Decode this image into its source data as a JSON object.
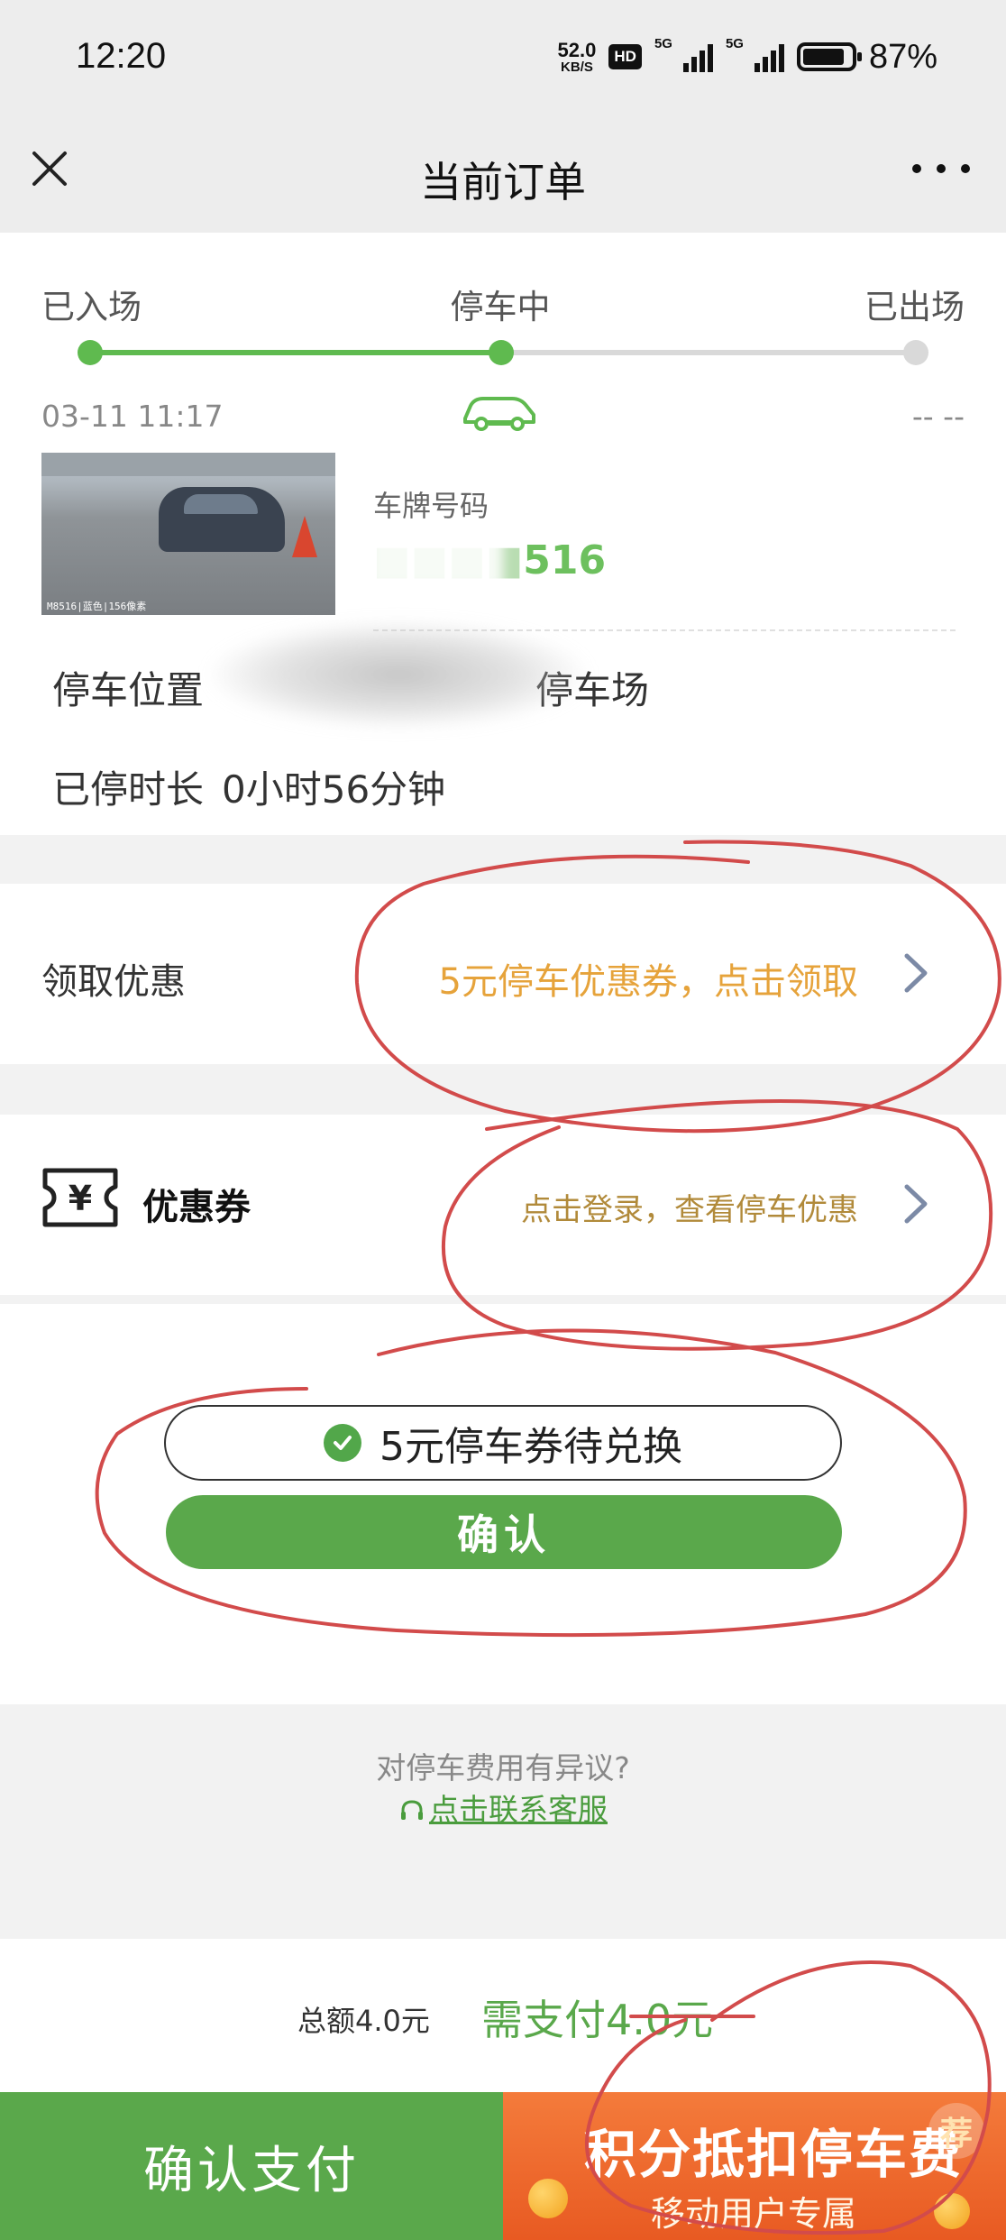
{
  "status_bar": {
    "time": "12:20",
    "net_speed_value": "52.0",
    "net_speed_unit": "KB/S",
    "hd_badge": "HD",
    "sim1_label": "5G",
    "sim2_label": "5G",
    "battery_percent": "87%",
    "battery_level": 0.87
  },
  "nav": {
    "title": "当前订单",
    "close_icon": "close-icon",
    "more_icon": "more-icon"
  },
  "progress": {
    "steps": [
      "已入场",
      "停车中",
      "已出场"
    ],
    "current_step_index": 1,
    "entry_time": "03-11 11:17",
    "exit_time": "-- --",
    "active_color": "#5fba4f",
    "inactive_color": "#d9d9d9"
  },
  "vehicle": {
    "photo_caption": "M8516|蓝色|156像素",
    "plate_label": "车牌号码",
    "plate_value": "516"
  },
  "details": {
    "location_label": "停车位置",
    "location_value": "停车场",
    "duration_label": "已停时长",
    "duration_value": "0小时56分钟"
  },
  "discount_row": {
    "label": "领取优惠",
    "action": "5元停车优惠券，点击领取"
  },
  "coupon_row": {
    "label": "优惠券",
    "action": "点击登录，查看停车优惠"
  },
  "exchange": {
    "pending_text": "5元停车券待兑换",
    "confirm_label": "确认"
  },
  "dispute": {
    "question": "对停车费用有异议?",
    "link": "点击联系客服"
  },
  "payment": {
    "total": "总额4.0元",
    "need_pay": "需支付4.0元",
    "pay_button": "确认支付",
    "points_title": "积分抵扣停车费",
    "points_subtitle": "移动用户专属",
    "points_badge": "荐"
  },
  "colors": {
    "brand_green": "#5aa84b",
    "action_orange": "#e6a33b",
    "points_orange": "#e85a22",
    "annotation_red": "#d24b4b"
  }
}
